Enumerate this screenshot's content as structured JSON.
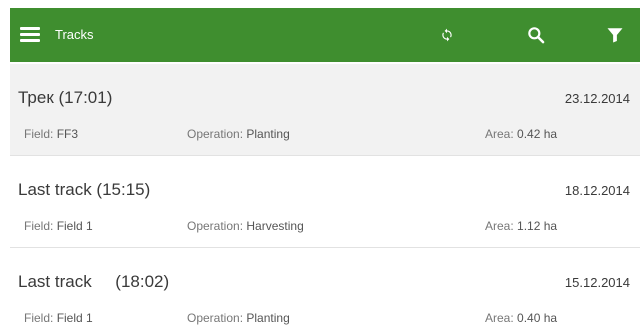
{
  "appbar": {
    "menu_icon": "hamburger-menu-icon",
    "title": "Tracks",
    "sync_icon": "sync-icon",
    "search_icon": "search-icon",
    "filter_icon": "filter-icon",
    "bg_color": "#3f8e2f"
  },
  "tracks": [
    {
      "name": "Трек (17:01)",
      "date": "23.12.2014",
      "field_label": "Field:",
      "field": "FF3",
      "operation_label": "Operation:",
      "operation": "Planting",
      "area_label": "Area:",
      "area": "0.42 ha"
    },
    {
      "name": "Last track (15:15)",
      "date": "18.12.2014",
      "field_label": "Field:",
      "field": "Field 1",
      "operation_label": "Operation:",
      "operation": "Harvesting",
      "area_label": "Area:",
      "area": "1.12 ha"
    },
    {
      "name": "Last track     (18:02)",
      "date": "15.12.2014",
      "field_label": "Field:",
      "field": "Field 1",
      "operation_label": "Operation:",
      "operation": "Planting",
      "area_label": "Area:",
      "area": "0.40 ha"
    }
  ]
}
